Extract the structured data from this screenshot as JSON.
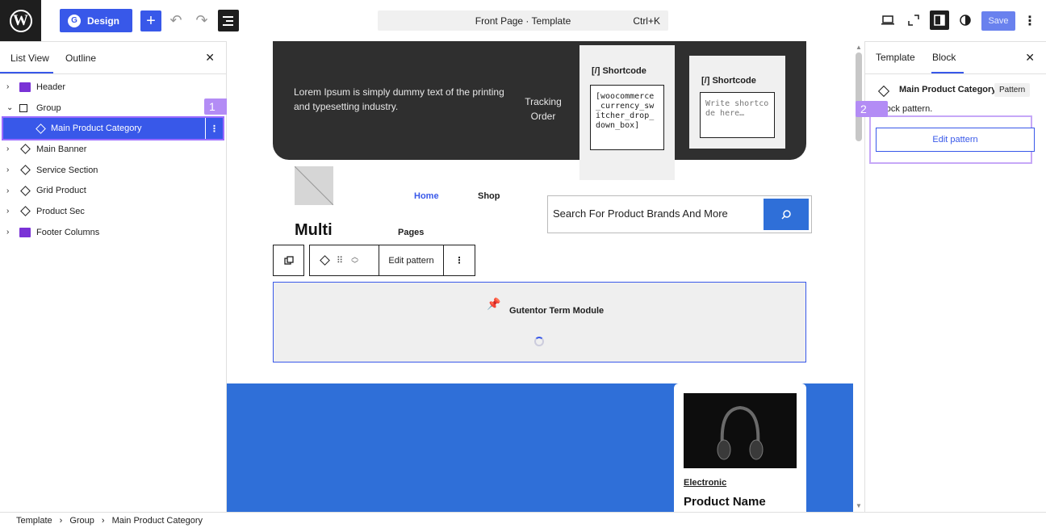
{
  "topbar": {
    "design_label": "Design",
    "design_icon": "G",
    "command_text": "Front Page · Template",
    "command_shortcut": "Ctrl+K",
    "save_label": "Save"
  },
  "left_panel": {
    "tab_list_view": "List View",
    "tab_outline": "Outline",
    "items": [
      {
        "label": "Header",
        "icon": "template-part-icon"
      },
      {
        "label": "Group",
        "icon": "group-icon"
      },
      {
        "label": "Main Product Category",
        "icon": "pattern-icon"
      },
      {
        "label": "Main Banner",
        "icon": "pattern-icon"
      },
      {
        "label": "Service Section",
        "icon": "pattern-icon"
      },
      {
        "label": "Grid Product",
        "icon": "pattern-icon"
      },
      {
        "label": "Product Sec",
        "icon": "pattern-icon"
      },
      {
        "label": "Footer Columns",
        "icon": "template-part-icon"
      }
    ]
  },
  "badges": {
    "one": "1",
    "two": "2"
  },
  "canvas": {
    "hero_text": "Lorem Ipsum is simply dummy text of the printing and typesetting industry.",
    "tracking_text": "Tracking Order",
    "shortcode1_title": "[/] Shortcode",
    "shortcode1_value": "[woocommerce_currency_switcher_drop_down_box]",
    "shortcode2_title": "[/] Shortcode",
    "shortcode2_placeholder": "Write shortcode here…",
    "nav_home": "Home",
    "nav_shop": "Shop",
    "nav_pages": "Pages",
    "site_title": "Multi",
    "search_placeholder": "Search For Product Brands And More",
    "toolbar_edit_pattern": "Edit pattern",
    "term_module_title": "Gutentor Term Module",
    "product_category": "Electronic",
    "product_name": "Product Name"
  },
  "right_panel": {
    "tab_template": "Template",
    "tab_block": "Block",
    "block_title": "Main Product Category",
    "block_badge": "Pattern",
    "block_desc": "Block pattern.",
    "edit_pattern_label": "Edit pattern"
  },
  "breadcrumb": [
    "Template",
    "Group",
    "Main Product Category"
  ],
  "colors": {
    "accent": "#3858e9",
    "highlight": "#b38cf5",
    "hero": "#2f2f2f",
    "band": "#2f6fd8"
  }
}
